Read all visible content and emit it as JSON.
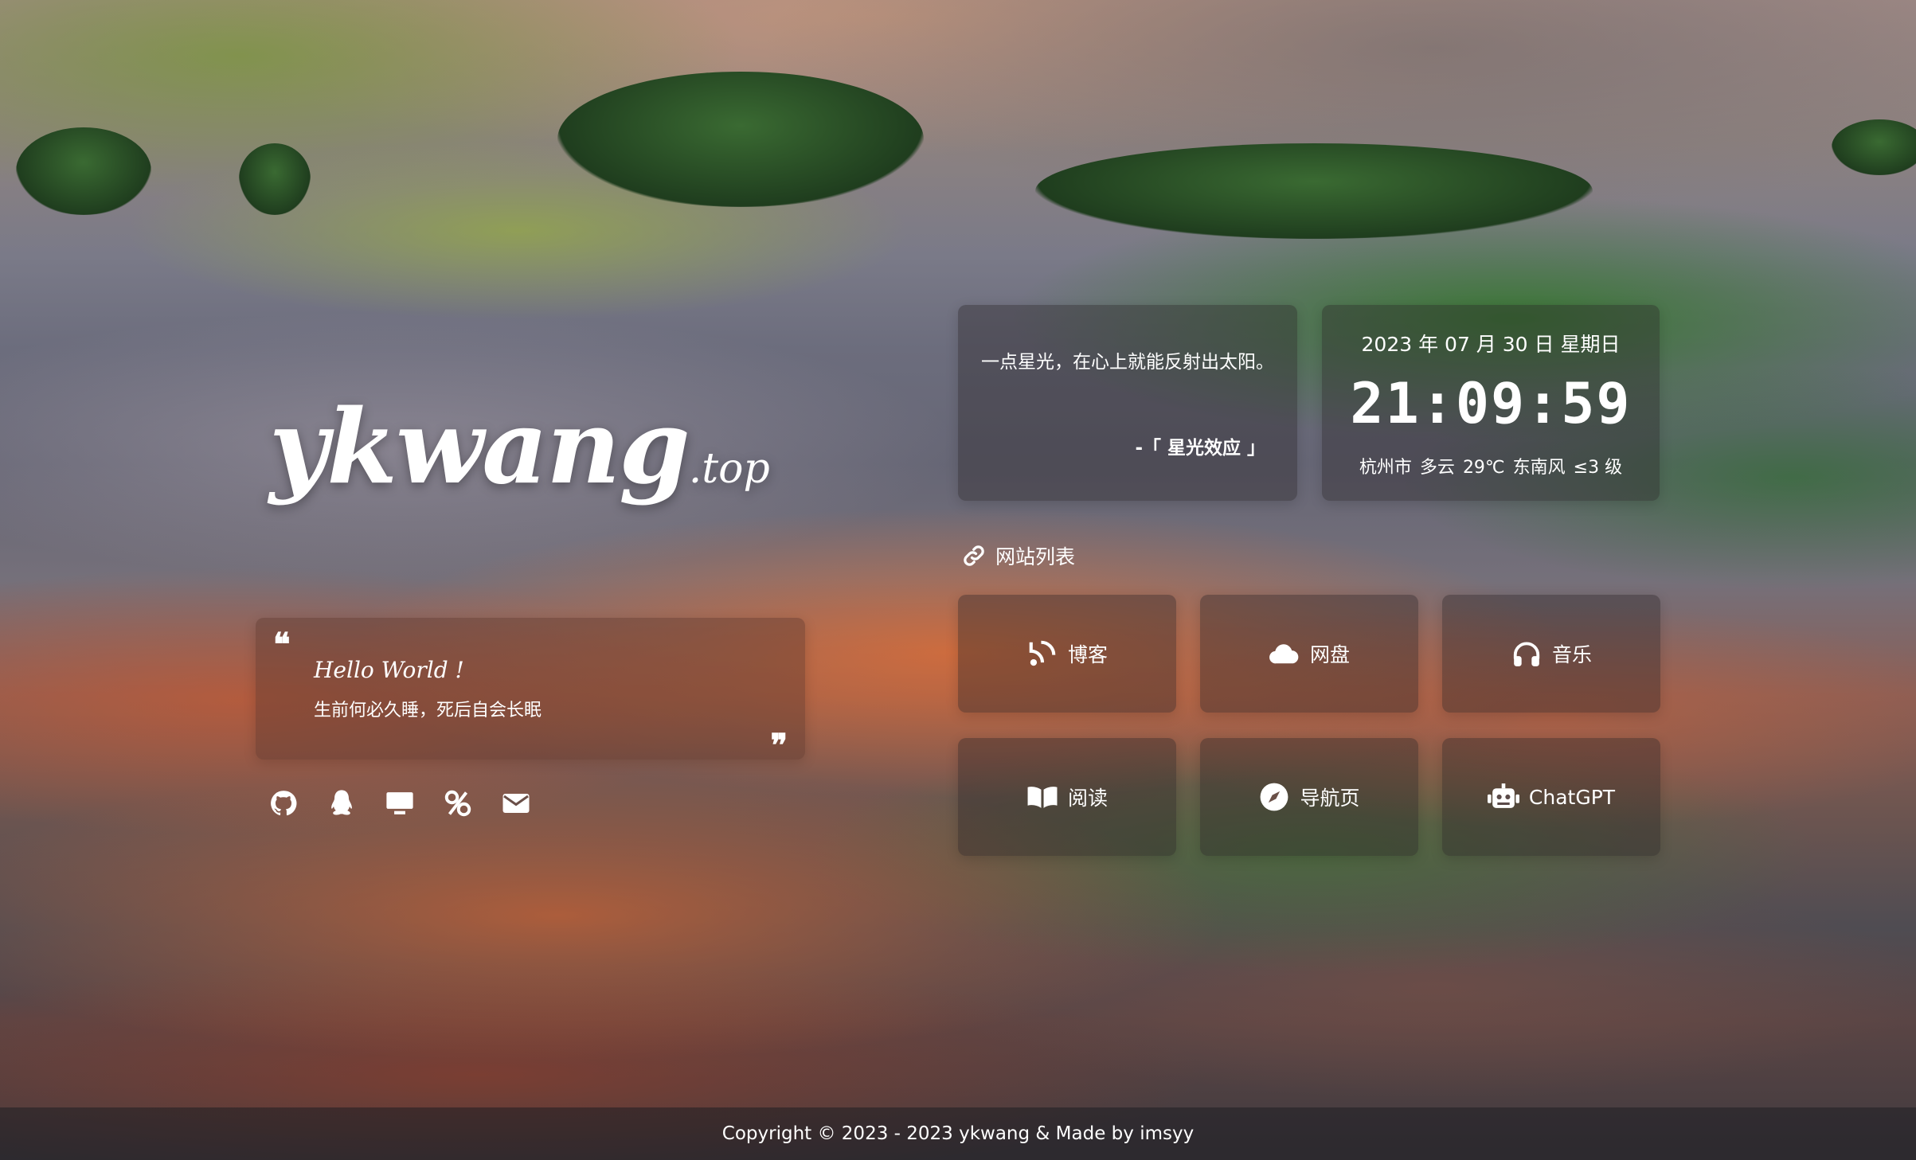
{
  "logo": {
    "name": "ykwang",
    "suffix": ".top"
  },
  "hello": {
    "title": "Hello World !",
    "text": "生前何必久睡，死后自会长眠"
  },
  "social_icons": [
    "github-icon",
    "qq-icon",
    "monitor-icon",
    "wechat-pay-icon",
    "email-icon"
  ],
  "quote": {
    "text": "一点星光，在心上就能反射出太阳。",
    "source": "-「 星光效应 」"
  },
  "clock": {
    "date": "2023 年 07 月 30 日 星期日",
    "time": "21:09:59"
  },
  "weather": {
    "city": "杭州市",
    "condition": "多云",
    "temp": "29℃",
    "wind_dir": "东南风",
    "wind_level": "≤3 级"
  },
  "links": {
    "heading": "网站列表",
    "items": [
      "博客",
      "网盘",
      "音乐",
      "阅读",
      "导航页",
      "ChatGPT"
    ],
    "icons": [
      "blog-icon",
      "cloud-icon",
      "headphones-icon",
      "book-icon",
      "compass-icon",
      "robot-icon"
    ]
  },
  "footer": {
    "copyright": "Copyright © 2023 - 2023 ykwang & Made by imsyy"
  }
}
